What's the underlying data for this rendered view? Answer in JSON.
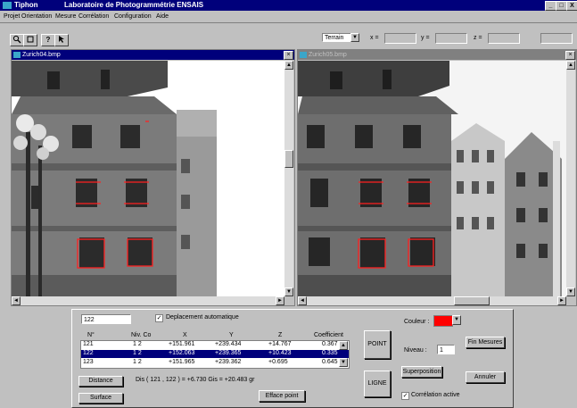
{
  "app": {
    "name": "Tiphon",
    "title": "Laboratoire de Photogrammétrie ENSAIS",
    "accent": "#00007b"
  },
  "window_buttons": [
    "_",
    "□",
    "X"
  ],
  "menu": [
    "Projet",
    "Orientation",
    "Mesure",
    "Corrélation",
    "Configuration",
    "Aide"
  ],
  "toolbar": {
    "icons": [
      "zoom-icon",
      "frame-icon",
      "help-icon",
      "pointer-help-icon"
    ],
    "mode_select": "Terrain",
    "x_label": "x =",
    "y_label": "y =",
    "z_label": "z ="
  },
  "left_image": {
    "title": "Zurich04.bmp"
  },
  "right_image": {
    "title": "Zurich05.bmp"
  },
  "panel": {
    "point_input": "122",
    "auto_move_label": "Deplacement automatique",
    "columns": [
      "N°",
      "Niv. Co",
      "X",
      "Y",
      "Z",
      "Coefficient"
    ],
    "rows": [
      {
        "n": "121",
        "niv": "1 2",
        "x": "+151.961",
        "y": "+239.434",
        "z": "+14.767",
        "c": "0.367"
      },
      {
        "n": "122",
        "niv": "1 2",
        "x": "+152.063",
        "y": "+239.365",
        "z": "+10.423",
        "c": "0.335"
      },
      {
        "n": "123",
        "niv": "1 2",
        "x": "+151.965",
        "y": "+239.362",
        "z": "+0.695",
        "c": "0.645"
      }
    ],
    "distance_btn": "Distance",
    "surface_btn": "Surface",
    "dist_text": "Dis ( 121 , 122 ) = +6.730  Gis = +20.483 gr",
    "efface_btn": "Efface point",
    "point_btn": "POINT",
    "ligne_btn": "LIGNE",
    "couleur_label": "Couleur :",
    "couleur_value": "#ff0000",
    "niveau_label": "Niveau :",
    "niveau_value": "1",
    "fin_btn": "Fin Mesures",
    "superposition_btn": "Superposition",
    "annuler_btn": "Annuler",
    "correlation_label": "Corrélation active"
  }
}
